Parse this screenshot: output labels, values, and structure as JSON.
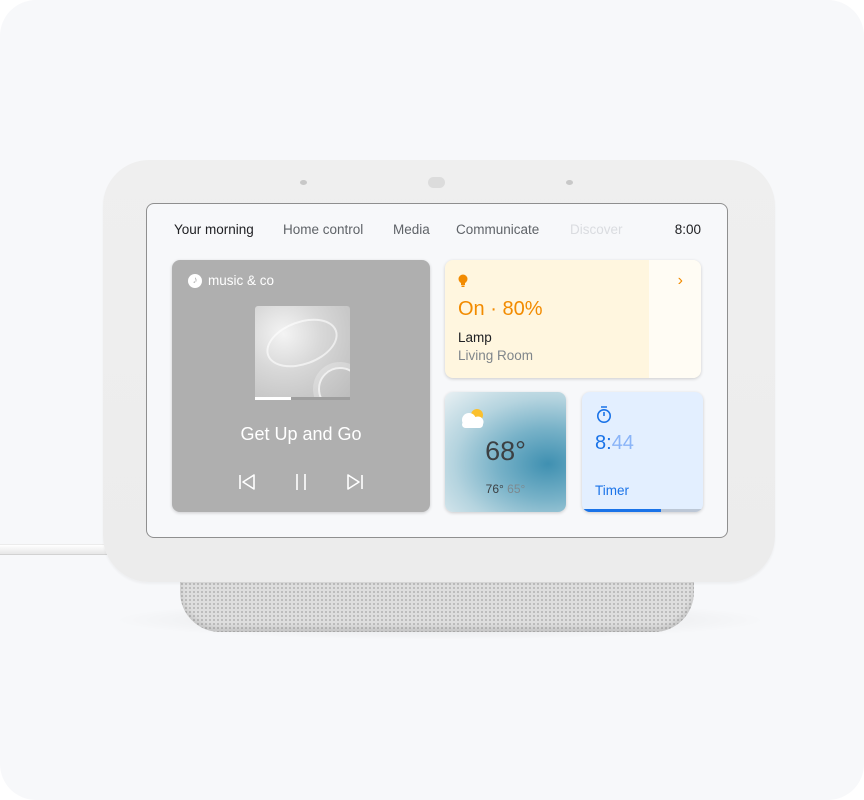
{
  "device": {
    "nav": {
      "tabs": [
        {
          "label": "Your morning",
          "state": "active"
        },
        {
          "label": "Home control",
          "state": "normal"
        },
        {
          "label": "Media",
          "state": "normal"
        },
        {
          "label": "Communicate",
          "state": "normal"
        },
        {
          "label": "Discover",
          "state": "faded"
        }
      ],
      "clock": "8:00"
    },
    "media": {
      "source": "music & co",
      "source_icon": "music-note-icon",
      "song_title": "Get Up and Go",
      "progress": 0.38,
      "controls": [
        "skip-previous-icon",
        "pause-icon",
        "skip-next-icon"
      ]
    },
    "lamp": {
      "icon": "lightbulb-icon",
      "state": "On · 80%",
      "name": "Lamp",
      "room": "Living Room",
      "chevron": "›",
      "accent": "#f28b00"
    },
    "weather": {
      "icon": "partly-cloudy-icon",
      "temperature": "68°",
      "high": "76°",
      "low": "65°"
    },
    "timer": {
      "icon": "stopwatch-icon",
      "time_main": "8:",
      "time_rest": "44",
      "label": "Timer",
      "progress": 0.65,
      "accent": "#1a73e8"
    }
  }
}
